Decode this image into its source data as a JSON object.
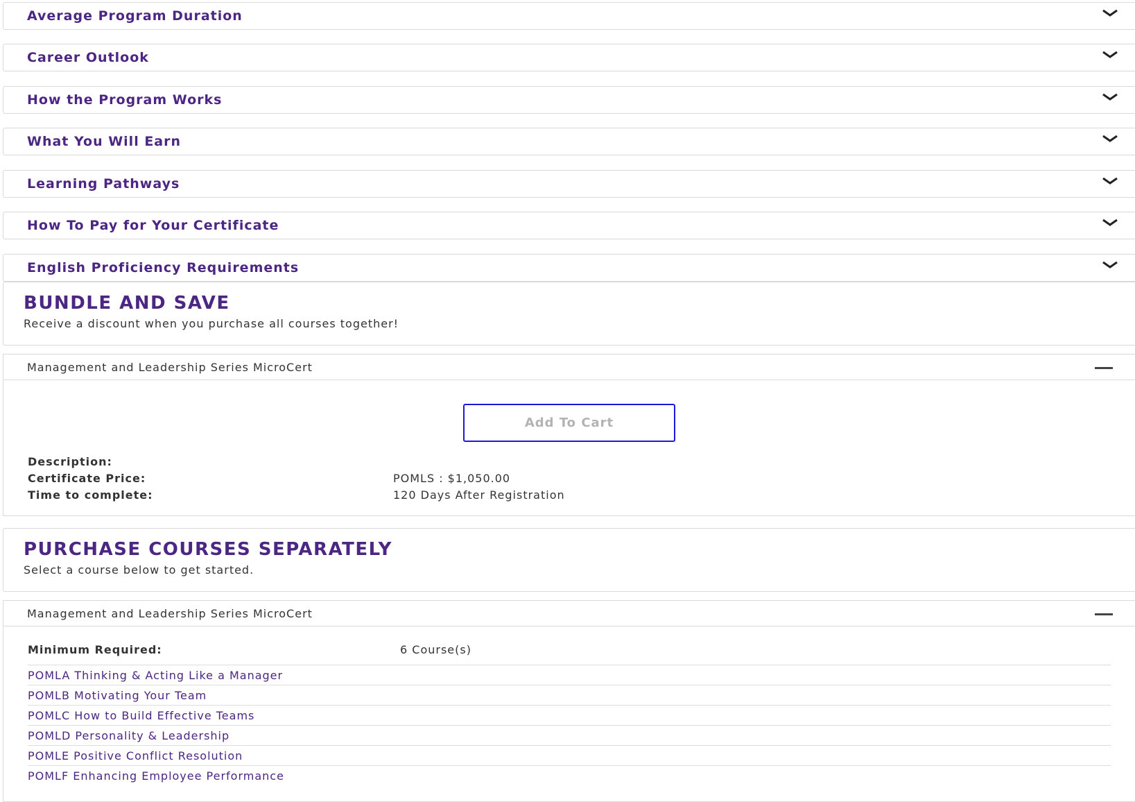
{
  "accordions": [
    {
      "label": "Average Program Duration"
    },
    {
      "label": "Career Outlook"
    },
    {
      "label": "How the Program Works"
    },
    {
      "label": "What You Will Earn"
    },
    {
      "label": "Learning Pathways"
    },
    {
      "label": "How To Pay for Your Certificate"
    },
    {
      "label": "English Proficiency Requirements"
    }
  ],
  "bundle": {
    "title": "BUNDLE AND SAVE",
    "subtitle": "Receive a discount when you purchase all courses together!",
    "panel_title": "Management and Leadership Series MicroCert",
    "add_to_cart": "Add To Cart",
    "description_label": "Description:",
    "price_label": "Certificate Price:",
    "price_value": "POMLS : $1,050.00",
    "time_label": "Time to complete:",
    "time_value": "120 Days After Registration"
  },
  "separate": {
    "title": "PURCHASE COURSES SEPARATELY",
    "subtitle": "Select a course below to get started.",
    "panel_title": "Management and Leadership Series MicroCert",
    "min_label": "Minimum Required:",
    "min_value": "6 Course(s)",
    "courses": [
      "POMLA Thinking & Acting Like a Manager",
      "POMLB Motivating Your Team",
      "POMLC How to Build Effective Teams",
      "POMLD Personality & Leadership",
      "POMLE Positive Conflict Resolution",
      "POMLF Enhancing Employee Performance"
    ]
  },
  "colors": {
    "brand_purple": "#4b2683",
    "button_border": "#1a1adb"
  }
}
